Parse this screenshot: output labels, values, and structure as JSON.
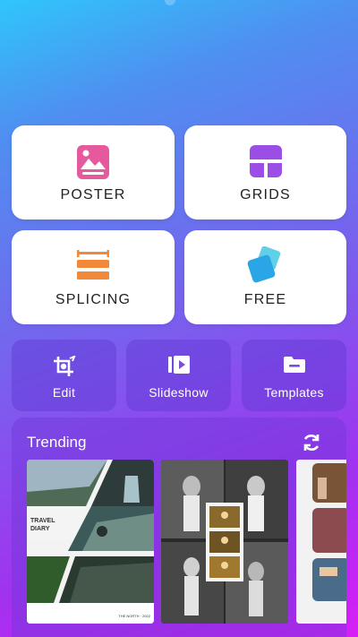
{
  "categories": [
    {
      "label": "POSTER",
      "icon": "poster-icon",
      "color": "#e55a9c"
    },
    {
      "label": "GRIDS",
      "icon": "grids-icon",
      "color": "#9b4ee6"
    },
    {
      "label": "SPLICING",
      "icon": "splicing-icon",
      "color": "#f1893a"
    },
    {
      "label": "FREE",
      "icon": "free-icon",
      "color": "#2aa6e6"
    }
  ],
  "tools": [
    {
      "label": "Edit",
      "icon": "crop-edit-icon"
    },
    {
      "label": "Slideshow",
      "icon": "slideshow-icon"
    },
    {
      "label": "Templates",
      "icon": "folder-icon"
    }
  ],
  "trending": {
    "title": "Trending",
    "refresh_icon": "refresh-icon",
    "templates": [
      {
        "caption": "TRAVEL\nDIARY",
        "footer": "THE NORTH · 2022"
      },
      {
        "caption": ""
      },
      {
        "caption": ""
      }
    ]
  }
}
